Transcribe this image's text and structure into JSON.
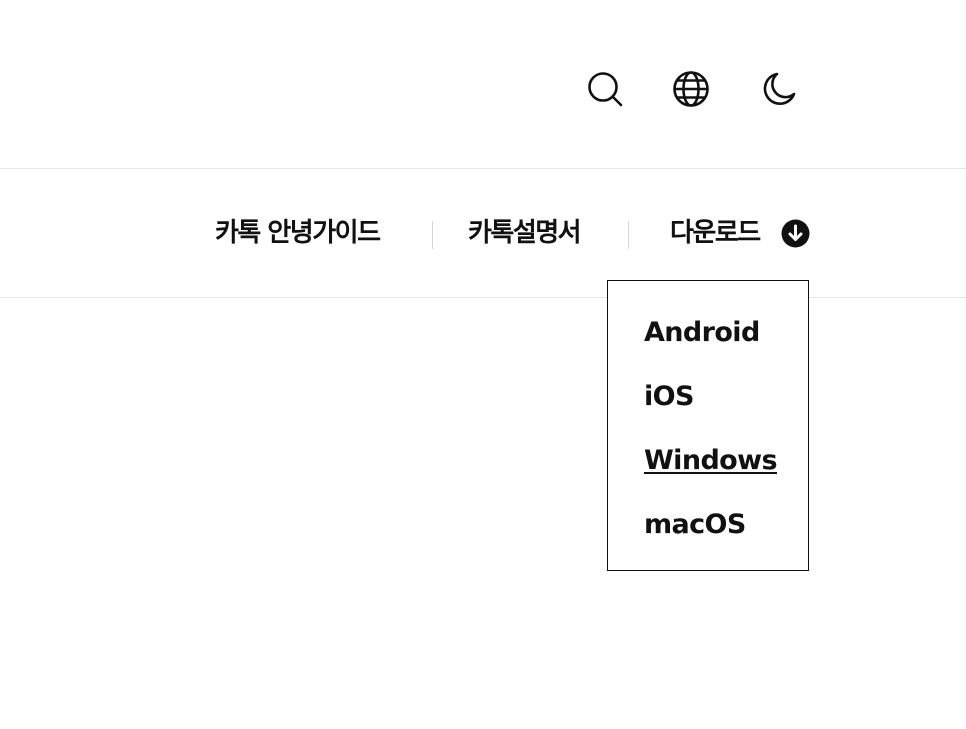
{
  "header": {
    "icons": {
      "search": "search-icon",
      "language": "globe-icon",
      "theme": "moon-icon"
    }
  },
  "nav": {
    "items": [
      {
        "label": "카톡 안녕가이드"
      },
      {
        "label": "카톡설명서"
      },
      {
        "label": "다운로드",
        "icon": "arrow-down-circle-icon"
      }
    ]
  },
  "download_menu": {
    "items": [
      {
        "label": "Android"
      },
      {
        "label": "iOS"
      },
      {
        "label": "Windows",
        "state": "hovered"
      },
      {
        "label": "macOS"
      }
    ]
  },
  "colors": {
    "text": "#111111",
    "divider": "#e6e6e6",
    "background": "#ffffff"
  }
}
